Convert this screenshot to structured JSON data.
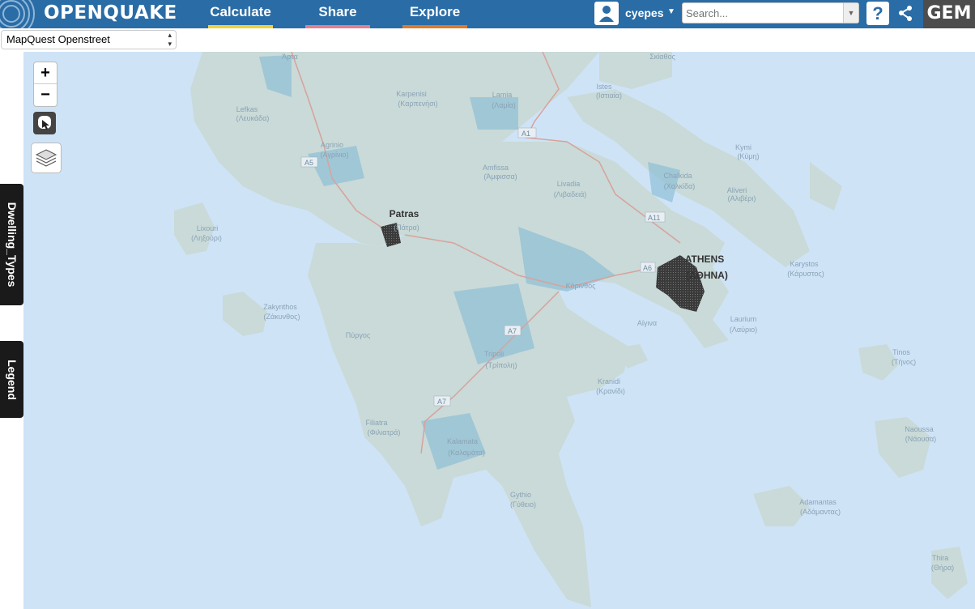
{
  "header": {
    "logo_text": "OPENQUAKE",
    "nav": [
      {
        "label": "Calculate",
        "color": "#f0d23a"
      },
      {
        "label": "Share",
        "color": "#e0808e"
      },
      {
        "label": "Explore",
        "color": "#e07a2a"
      }
    ],
    "user_name": "cyepes",
    "search_placeholder": "Search...",
    "help_label": "?",
    "gem_label": "GEM"
  },
  "basemap": {
    "selected": "MapQuest Openstreet"
  },
  "side_tabs": {
    "dwelling": "Dwelling_Types",
    "legend": "Legend"
  },
  "zoom": {
    "in": "+",
    "out": "−"
  },
  "map": {
    "roads": [
      "A1",
      "A5",
      "A11",
      "A6",
      "A7",
      "A7"
    ],
    "places": [
      {
        "name": "Άρτα",
        "sub": ""
      },
      {
        "name": "Σκίαθος",
        "sub": ""
      },
      {
        "name": "Istes",
        "sub": "(Ιστιαία)"
      },
      {
        "name": "Karpenisi",
        "sub": "(Καρπενήσι)"
      },
      {
        "name": "Lamia",
        "sub": "(Λαμία)"
      },
      {
        "name": "Lefkas",
        "sub": "(Λευκάδα)"
      },
      {
        "name": "Agrinio",
        "sub": "(Αγρίνιο)"
      },
      {
        "name": "Amfissa",
        "sub": "(Άμφισσα)"
      },
      {
        "name": "Kymi",
        "sub": "(Κύμη)"
      },
      {
        "name": "Chalkida",
        "sub": "(Χαλκίδα)"
      },
      {
        "name": "Livadia",
        "sub": "(Λιβαδειά)"
      },
      {
        "name": "Aliveri",
        "sub": "(Αλιβέρι)"
      },
      {
        "name": "Patras",
        "sub": "(Πάτρα)"
      },
      {
        "name": "Lixouri",
        "sub": "(Ληξούρι)"
      },
      {
        "name": "ATHENS",
        "sub": "(ΑΘΗΝΑ)"
      },
      {
        "name": "Karystos",
        "sub": "(Κάρυστος)"
      },
      {
        "name": "Κόρινθος",
        "sub": ""
      },
      {
        "name": "Zakynthos",
        "sub": "(Ζάκυνθος)"
      },
      {
        "name": "Laurium",
        "sub": "(Λαύριο)"
      },
      {
        "name": "Αίγινα",
        "sub": ""
      },
      {
        "name": "Πύργος",
        "sub": ""
      },
      {
        "name": "Tripoli",
        "sub": "(Τρίπολη)"
      },
      {
        "name": "Tinos",
        "sub": "(Τήνος)"
      },
      {
        "name": "Kranidi",
        "sub": "(Κρανίδι)"
      },
      {
        "name": "Filiatra",
        "sub": "(Φιλιατρά)"
      },
      {
        "name": "Naoussa",
        "sub": "(Νάουσα)"
      },
      {
        "name": "Kalamata",
        "sub": "(Καλαμάτα)"
      },
      {
        "name": "Gythio",
        "sub": "(Γύθειο)"
      },
      {
        "name": "Adamantas",
        "sub": "(Αδάμαντας)"
      },
      {
        "name": "Thira",
        "sub": "(Θήρα)"
      }
    ]
  },
  "colors": {
    "header_bg": "#2a6ca6",
    "sea": "#cfe3f7",
    "land": "#c9dad8",
    "density_high": "#2b2b2b",
    "density_mid": "#6aa8c6",
    "roads": "#d8a29c"
  }
}
